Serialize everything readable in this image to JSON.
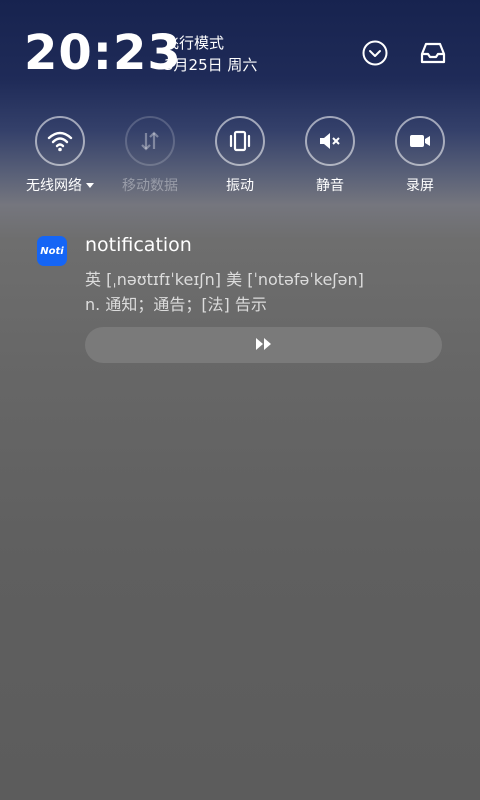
{
  "status_bar": {
    "time": "20:23",
    "mode": "飞行模式",
    "date": "3月25日 周六"
  },
  "quick_settings": {
    "tiles": [
      {
        "label": "无线网络",
        "icon": "wifi-icon",
        "enabled": true,
        "has_dropdown": true
      },
      {
        "label": "移动数据",
        "icon": "mobile-data-icon",
        "enabled": false
      },
      {
        "label": "振动",
        "icon": "vibrate-icon",
        "enabled": true
      },
      {
        "label": "静音",
        "icon": "mute-icon",
        "enabled": true
      },
      {
        "label": "录屏",
        "icon": "screen-record-icon",
        "enabled": true
      }
    ]
  },
  "notification": {
    "app_icon_text": "Noti",
    "title": "notification",
    "phonetic": "英 [ˌnəʊtɪfɪˈkeɪʃn]  美 [ˈnotəfəˈkeʃən]",
    "meaning": "n. 通知；通告；[法] 告示",
    "play_icon": "fast-forward-icon"
  },
  "colors": {
    "accent_blue": "#1565f5",
    "header_navy": "#17234f"
  }
}
